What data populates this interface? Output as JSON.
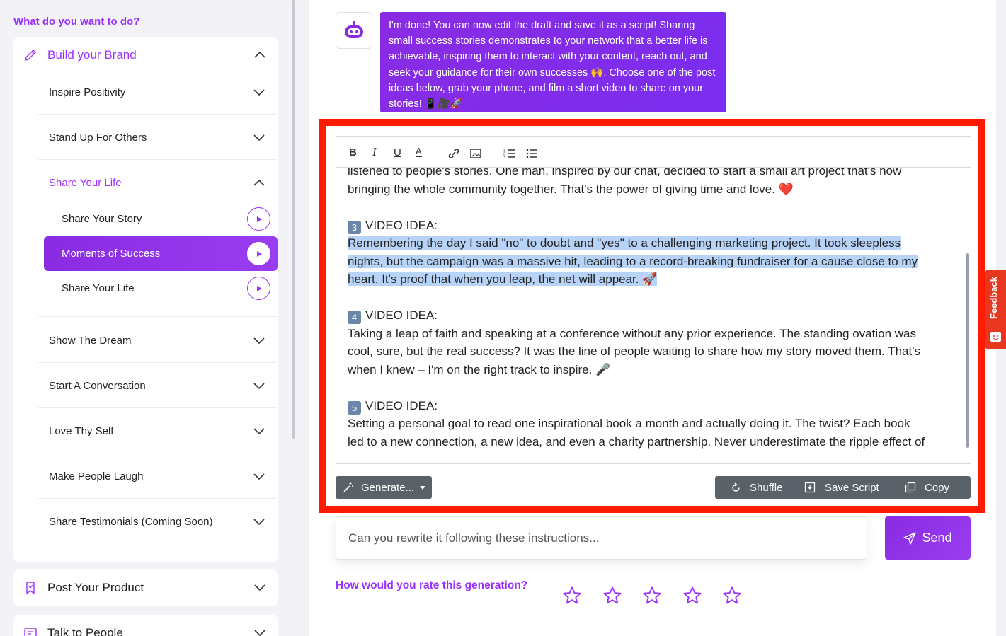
{
  "sidebar": {
    "heading": "What do you want to do?",
    "brand": {
      "title": "Build your Brand",
      "items": [
        {
          "label": "Inspire Positivity"
        },
        {
          "label": "Stand Up For Others"
        },
        {
          "label": "Share Your Life"
        },
        {
          "label": "Show The Dream"
        },
        {
          "label": "Start A Conversation"
        },
        {
          "label": "Love Thy Self"
        },
        {
          "label": "Make People Laugh"
        },
        {
          "label": "Share Testimonials (Coming Soon)"
        }
      ],
      "leaves": [
        {
          "label": "Share Your Story"
        },
        {
          "label": "Moments of Success"
        },
        {
          "label": "Share Your Life"
        }
      ]
    },
    "product": {
      "title": "Post Your Product"
    },
    "people": {
      "title": "Talk to People"
    }
  },
  "chat": {
    "bot_message": "I'm done! You can now edit the draft and save it as a script! Sharing small success stories demonstrates to your network that a better life is achievable, inspiring them to interact with your content, reach out, and seek your guidance for their own successes 🙌. Choose one of the post ideas below, grab your phone, and film a short video to share on your stories! 📱🎥🚀"
  },
  "editor": {
    "toolbar": {
      "bold": "B",
      "italic": "I",
      "underline": "U",
      "color": "A"
    },
    "p2_line1": "listened to people's stories. One man, inspired by our chat, decided to start a small art project that's now",
    "p2_line2": "bringing the whole community together. That's the power of giving time and love. ❤️",
    "idea3_num": "3",
    "idea3_head": "VIDEO IDEA:",
    "idea3_l1": "Remembering the day I said \"no\" to doubt and \"yes\" to a challenging marketing project. It took sleepless",
    "idea3_l2": "nights, but the campaign was a massive hit, leading to a record-breaking fundraiser for a cause close to my",
    "idea3_l3": "heart. It's proof that when you leap, the net will appear. 🚀",
    "idea4_num": "4",
    "idea4_head": "VIDEO IDEA:",
    "idea4_l1": "Taking a leap of faith and speaking at a conference without any prior experience. The standing ovation was",
    "idea4_l2": "cool, sure, but the real success? It was the line of people waiting to share how my story moved them. That's",
    "idea4_l3": "when I knew – I'm on the right track to inspire. 🎤",
    "idea5_num": "5",
    "idea5_head": "VIDEO IDEA:",
    "idea5_l1": "Setting a personal goal to read one inspirational book a month and actually doing it. The twist? Each book",
    "idea5_l2": "led to a new connection, a new idea, and even a charity partnership. Never underestimate the ripple effect of"
  },
  "actions": {
    "generate": "Generate...",
    "shuffle": "Shuffle",
    "save_script": "Save Script",
    "copy": "Copy"
  },
  "instruction": {
    "placeholder": "Can you rewrite it following these instructions...",
    "send": "Send"
  },
  "rating": {
    "label": "How would you rate this generation?",
    "stars": 5,
    "value": 0
  },
  "feedback_tab": "Feedback",
  "colors": {
    "accent": "#9b30ff",
    "highlight": "#ff1a00",
    "selection": "#b7d3f7"
  }
}
